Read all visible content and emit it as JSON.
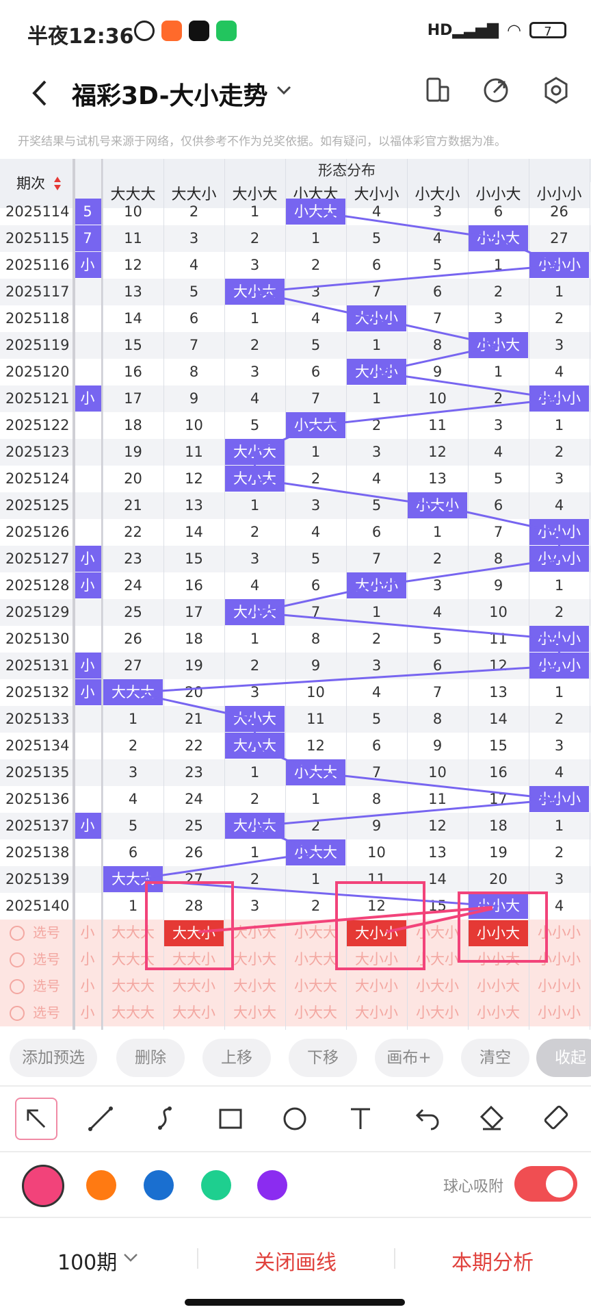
{
  "status": {
    "time": "半夜12:36",
    "battery": "7"
  },
  "header": {
    "title": "福彩3D-大小走势"
  },
  "disclaimer": "开奖结果与试机号来源于网络，仅供参考不作为兑奖依据。如有疑问，以福体彩官方数据为准。",
  "table": {
    "period_header": "期次",
    "group_header": "形态分布",
    "columns": [
      "大大大",
      "大大小",
      "大小大",
      "小大大",
      "大小小",
      "小大小",
      "小小大",
      "小小小"
    ],
    "partial_col": [
      "5",
      "7",
      "小",
      "",
      "",
      "",
      "",
      "小",
      "",
      "",
      "",
      "",
      "",
      "小",
      "小",
      "",
      "",
      "小",
      "小",
      "",
      "",
      "",
      "",
      "小",
      "",
      "",
      "",
      ""
    ],
    "rows": [
      {
        "period": "2025114",
        "hit": 3,
        "vals": [
          "10",
          "2",
          "1",
          "小大大",
          "4",
          "3",
          "6",
          "26"
        ]
      },
      {
        "period": "2025115",
        "hit": 6,
        "vals": [
          "11",
          "3",
          "2",
          "1",
          "5",
          "4",
          "小小大",
          "27"
        ]
      },
      {
        "period": "2025116",
        "hit": 7,
        "vals": [
          "12",
          "4",
          "3",
          "2",
          "6",
          "5",
          "1",
          "小小小"
        ]
      },
      {
        "period": "2025117",
        "hit": 2,
        "vals": [
          "13",
          "5",
          "大小大",
          "3",
          "7",
          "6",
          "2",
          "1"
        ]
      },
      {
        "period": "2025118",
        "hit": 4,
        "vals": [
          "14",
          "6",
          "1",
          "4",
          "大小小",
          "7",
          "3",
          "2"
        ]
      },
      {
        "period": "2025119",
        "hit": 6,
        "vals": [
          "15",
          "7",
          "2",
          "5",
          "1",
          "8",
          "小小大",
          "3"
        ]
      },
      {
        "period": "2025120",
        "hit": 4,
        "vals": [
          "16",
          "8",
          "3",
          "6",
          "大小小",
          "9",
          "1",
          "4"
        ]
      },
      {
        "period": "2025121",
        "hit": 7,
        "vals": [
          "17",
          "9",
          "4",
          "7",
          "1",
          "10",
          "2",
          "小小小"
        ]
      },
      {
        "period": "2025122",
        "hit": 3,
        "vals": [
          "18",
          "10",
          "5",
          "小大大",
          "2",
          "11",
          "3",
          "1"
        ]
      },
      {
        "period": "2025123",
        "hit": 2,
        "vals": [
          "19",
          "11",
          "大小大",
          "1",
          "3",
          "12",
          "4",
          "2"
        ]
      },
      {
        "period": "2025124",
        "hit": 2,
        "vals": [
          "20",
          "12",
          "大小大",
          "2",
          "4",
          "13",
          "5",
          "3"
        ]
      },
      {
        "period": "2025125",
        "hit": 5,
        "vals": [
          "21",
          "13",
          "1",
          "3",
          "5",
          "小大小",
          "6",
          "4"
        ]
      },
      {
        "period": "2025126",
        "hit": 7,
        "vals": [
          "22",
          "14",
          "2",
          "4",
          "6",
          "1",
          "7",
          "小小小"
        ]
      },
      {
        "period": "2025127",
        "hit": 7,
        "vals": [
          "23",
          "15",
          "3",
          "5",
          "7",
          "2",
          "8",
          "小小小"
        ]
      },
      {
        "period": "2025128",
        "hit": 4,
        "vals": [
          "24",
          "16",
          "4",
          "6",
          "大小小",
          "3",
          "9",
          "1"
        ]
      },
      {
        "period": "2025129",
        "hit": 2,
        "vals": [
          "25",
          "17",
          "大小大",
          "7",
          "1",
          "4",
          "10",
          "2"
        ]
      },
      {
        "period": "2025130",
        "hit": 7,
        "vals": [
          "26",
          "18",
          "1",
          "8",
          "2",
          "5",
          "11",
          "小小小"
        ]
      },
      {
        "period": "2025131",
        "hit": 7,
        "vals": [
          "27",
          "19",
          "2",
          "9",
          "3",
          "6",
          "12",
          "小小小"
        ]
      },
      {
        "period": "2025132",
        "hit": 0,
        "vals": [
          "大大大",
          "20",
          "3",
          "10",
          "4",
          "7",
          "13",
          "1"
        ]
      },
      {
        "period": "2025133",
        "hit": 2,
        "vals": [
          "1",
          "21",
          "大小大",
          "11",
          "5",
          "8",
          "14",
          "2"
        ]
      },
      {
        "period": "2025134",
        "hit": 2,
        "vals": [
          "2",
          "22",
          "大小大",
          "12",
          "6",
          "9",
          "15",
          "3"
        ]
      },
      {
        "period": "2025135",
        "hit": 3,
        "vals": [
          "3",
          "23",
          "1",
          "小大大",
          "7",
          "10",
          "16",
          "4"
        ]
      },
      {
        "period": "2025136",
        "hit": 7,
        "vals": [
          "4",
          "24",
          "2",
          "1",
          "8",
          "11",
          "17",
          "小小小"
        ]
      },
      {
        "period": "2025137",
        "hit": 2,
        "vals": [
          "5",
          "25",
          "大小大",
          "2",
          "9",
          "12",
          "18",
          "1"
        ]
      },
      {
        "period": "2025138",
        "hit": 3,
        "vals": [
          "6",
          "26",
          "1",
          "小大大",
          "10",
          "13",
          "19",
          "2"
        ]
      },
      {
        "period": "2025139",
        "hit": 0,
        "vals": [
          "大大大",
          "27",
          "2",
          "1",
          "11",
          "14",
          "20",
          "3"
        ]
      },
      {
        "period": "2025140",
        "hit": 6,
        "vals": [
          "1",
          "28",
          "3",
          "2",
          "12",
          "15",
          "小小大",
          "4"
        ]
      }
    ],
    "pick_rows": [
      {
        "label": "选号",
        "red": [
          1,
          4,
          6
        ]
      },
      {
        "label": "选号",
        "red": []
      },
      {
        "label": "选号",
        "red": []
      },
      {
        "label": "选号",
        "red": []
      }
    ],
    "pick_partial": "小"
  },
  "actions": [
    "添加预选",
    "删除",
    "上移",
    "下移",
    "画布+",
    "清空",
    "收起"
  ],
  "tools": [
    "arrow-tool-icon",
    "line-tool-icon",
    "curve-tool-icon",
    "rectangle-tool-icon",
    "circle-tool-icon",
    "text-tool-icon",
    "undo-icon",
    "eraser-icon",
    "clear-canvas-icon"
  ],
  "colors": {
    "pink": "#f2437a",
    "orange": "#ff7a12",
    "blue": "#1a6fd0",
    "green": "#1ecf8f",
    "purple": "#8b2cf0",
    "accent": "#7765f0",
    "red": "#e53935"
  },
  "snap_label": "球心吸附",
  "bottom": {
    "periods": "100期",
    "close_lines": "关闭画线",
    "analysis": "本期分析"
  }
}
